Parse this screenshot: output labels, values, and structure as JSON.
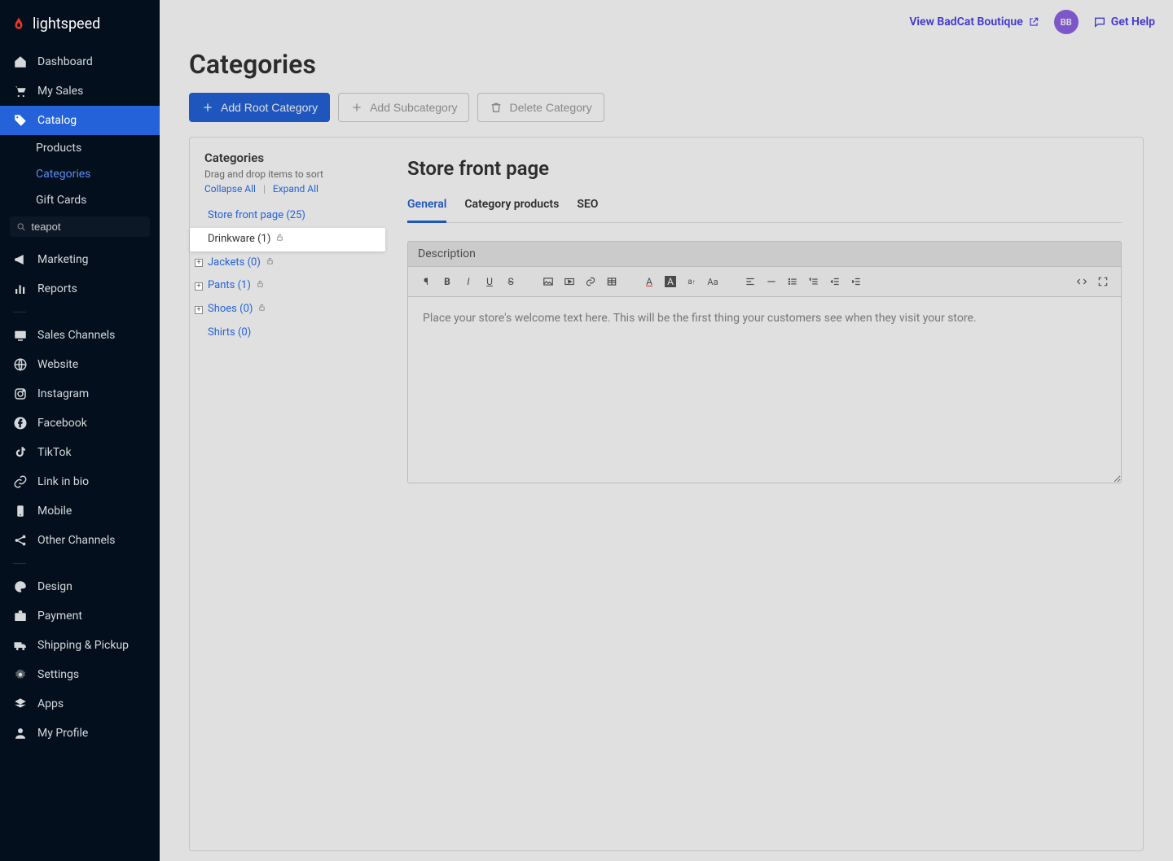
{
  "brand": "lightspeed",
  "topbar": {
    "view_store": "View BadCat Boutique",
    "avatar_initials": "BB",
    "get_help": "Get Help"
  },
  "sidebar": {
    "items": [
      {
        "key": "dashboard",
        "label": "Dashboard"
      },
      {
        "key": "my-sales",
        "label": "My Sales"
      },
      {
        "key": "catalog",
        "label": "Catalog"
      }
    ],
    "catalog_sub": [
      {
        "key": "products",
        "label": "Products"
      },
      {
        "key": "categories",
        "label": "Categories"
      },
      {
        "key": "gift-cards",
        "label": "Gift Cards"
      }
    ],
    "search_value": "teapot",
    "items2": [
      {
        "key": "marketing",
        "label": "Marketing"
      },
      {
        "key": "reports",
        "label": "Reports"
      }
    ],
    "items3": [
      {
        "key": "sales-channels",
        "label": "Sales Channels"
      },
      {
        "key": "website",
        "label": "Website"
      },
      {
        "key": "instagram",
        "label": "Instagram"
      },
      {
        "key": "facebook",
        "label": "Facebook"
      },
      {
        "key": "tiktok",
        "label": "TikTok"
      },
      {
        "key": "link-in-bio",
        "label": "Link in bio"
      },
      {
        "key": "mobile",
        "label": "Mobile"
      },
      {
        "key": "other-channels",
        "label": "Other Channels"
      }
    ],
    "items4": [
      {
        "key": "design",
        "label": "Design"
      },
      {
        "key": "payment",
        "label": "Payment"
      },
      {
        "key": "shipping",
        "label": "Shipping & Pickup"
      },
      {
        "key": "settings",
        "label": "Settings"
      },
      {
        "key": "apps",
        "label": "Apps"
      },
      {
        "key": "my-profile",
        "label": "My Profile"
      }
    ]
  },
  "page": {
    "title": "Categories",
    "btn_add_root": "Add Root Category",
    "btn_add_sub": "Add Subcategory",
    "btn_delete": "Delete Category"
  },
  "tree": {
    "title": "Categories",
    "hint": "Drag and drop items to sort",
    "collapse": "Collapse All",
    "expand": "Expand All",
    "items": [
      {
        "label": "Store front page (25)",
        "expander": "none",
        "lock": false
      },
      {
        "label": "Drinkware (1)",
        "expander": "none",
        "lock": true,
        "selected": true
      },
      {
        "label": "Jackets (0)",
        "expander": "plus",
        "lock": true
      },
      {
        "label": "Pants (1)",
        "expander": "plus",
        "lock": true
      },
      {
        "label": "Shoes (0)",
        "expander": "plus",
        "lock": true
      },
      {
        "label": "Shirts (0)",
        "expander": "none",
        "lock": false
      }
    ]
  },
  "editor": {
    "heading": "Store front page",
    "tabs": [
      {
        "key": "general",
        "label": "General"
      },
      {
        "key": "products",
        "label": "Category products"
      },
      {
        "key": "seo",
        "label": "SEO"
      }
    ],
    "field_label": "Description",
    "placeholder": "Place your store's welcome text here. This will be the first thing your customers see when they visit your store."
  }
}
